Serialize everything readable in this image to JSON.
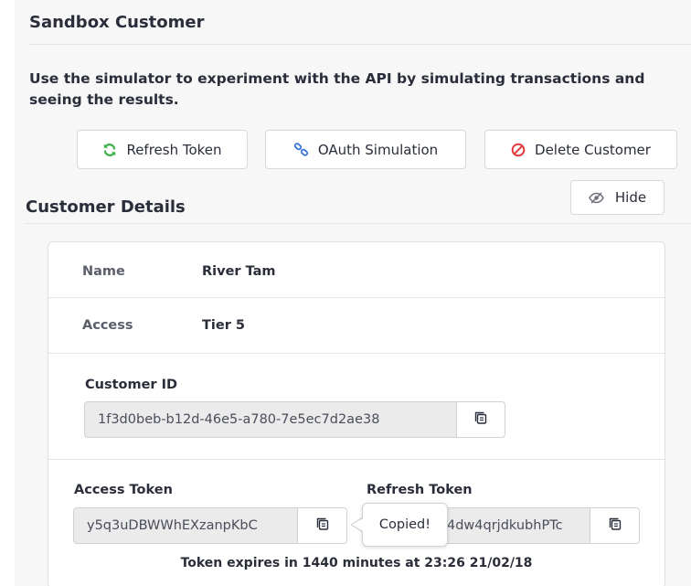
{
  "header": {
    "title": "Sandbox Customer"
  },
  "intro": {
    "text": "Use the simulator to experiment with the API by simulating transactions and seeing the results."
  },
  "actions": {
    "refresh_label": "Refresh Token",
    "oauth_label": "OAuth Simulation",
    "delete_label": "Delete Customer",
    "hide_label": "Hide"
  },
  "details": {
    "title": "Customer Details",
    "name_label": "Name",
    "name_value": "River Tam",
    "access_label": "Access",
    "access_value": "Tier 5",
    "customer_id_label": "Customer ID",
    "customer_id_value": "1f3d0beb-b12d-46e5-a780-7e5ec7d2ae38",
    "access_token_label": "Access Token",
    "access_token_value": "y5q3uDBWWhEXzanpKbC",
    "refresh_token_label": "Refresh Token",
    "refresh_token_value": "4dw4qrjdkubhPTc",
    "tooltip": "Copied!",
    "expiry": "Token expires in 1440 minutes at 23:26 21/02/18"
  },
  "colors": {
    "refresh_icon": "#3bb14b",
    "oauth_icon": "#3b73d9",
    "delete_icon": "#e23a3a",
    "text": "#2a2d3a",
    "panel_bg": "#f7f7f8"
  },
  "icons": {
    "refresh": "refresh-icon",
    "oauth": "link-icon",
    "delete": "prohibited-icon",
    "hide": "eye-slash-icon",
    "copy": "copy-icon"
  }
}
